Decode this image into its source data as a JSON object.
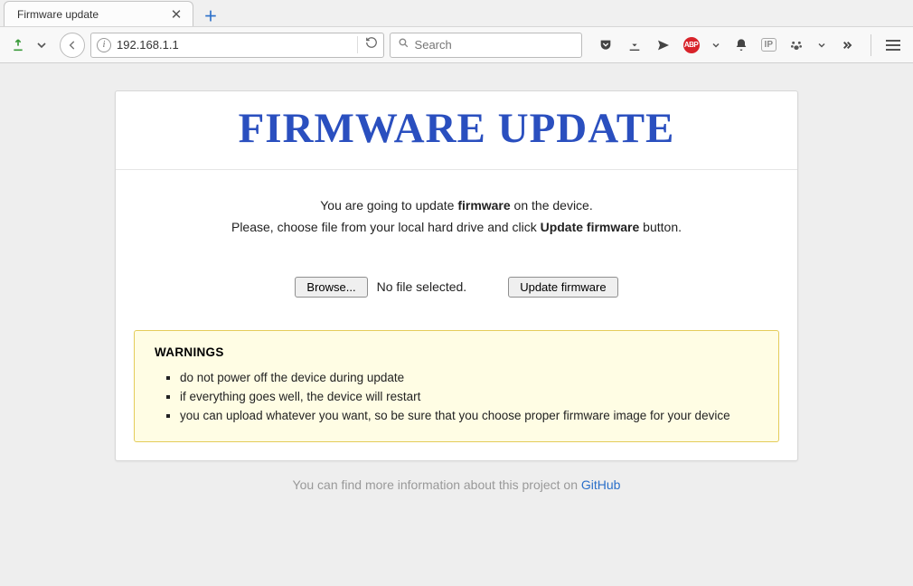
{
  "browser": {
    "tab_title": "Firmware update",
    "url": "192.168.1.1",
    "search_placeholder": "Search"
  },
  "page": {
    "title": "FIRMWARE UPDATE",
    "intro_pre": "You are going to update ",
    "intro_bold1": "firmware",
    "intro_post1": " on the device.",
    "intro_line2_pre": "Please, choose file from your local hard drive and click ",
    "intro_bold2": "Update firmware",
    "intro_line2_post": " button.",
    "browse_label": "Browse...",
    "file_status": "No file selected.",
    "update_label": "Update firmware",
    "warnings_heading": "WARNINGS",
    "warnings": [
      "do not power off the device during update",
      "if everything goes well, the device will restart",
      "you can upload whatever you want, so be sure that you choose proper firmware image for your device"
    ],
    "footer_text": "You can find more information about this project on ",
    "footer_link": "GitHub"
  }
}
